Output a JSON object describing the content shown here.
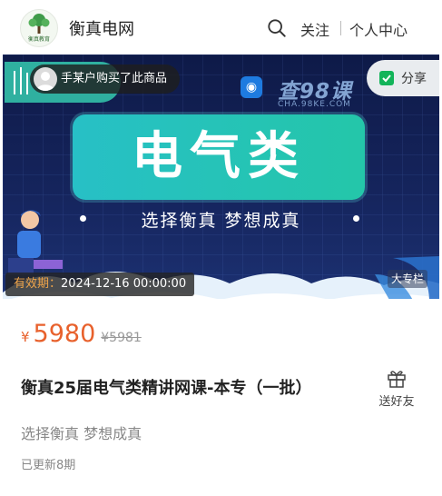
{
  "header": {
    "site_name": "衡真电网",
    "follow_label": "关注",
    "user_center_label": "个人中心",
    "logo_text": "衡真教育"
  },
  "banner": {
    "purchase_notice": "手某户购买了此商品",
    "share_label": "分享",
    "watermark_text": "查98课",
    "watermark_url": "CHA.98KE.COM",
    "category_heading": "电气类",
    "slogan": "选择衡真 梦想成真",
    "validity_label": "有效期：",
    "validity_date": "2024-12-16 00:00:00",
    "category_tag": "大专栏"
  },
  "product": {
    "price_symbol": "¥",
    "price": "5980",
    "original_price": "¥5981",
    "title": "衡真25届电气类精讲网课-本专（一批）",
    "gift_label": "送好友",
    "slogan": "选择衡真 梦想成真",
    "update_status": "已更新8期"
  },
  "colors": {
    "accent_price": "#e8612c",
    "banner_bg": "#15245c",
    "category_card": "#25c3b8",
    "share_green": "#13b45a"
  },
  "icons": {
    "search": "search-icon",
    "share": "wechat-share-icon",
    "gift": "gift-icon"
  }
}
